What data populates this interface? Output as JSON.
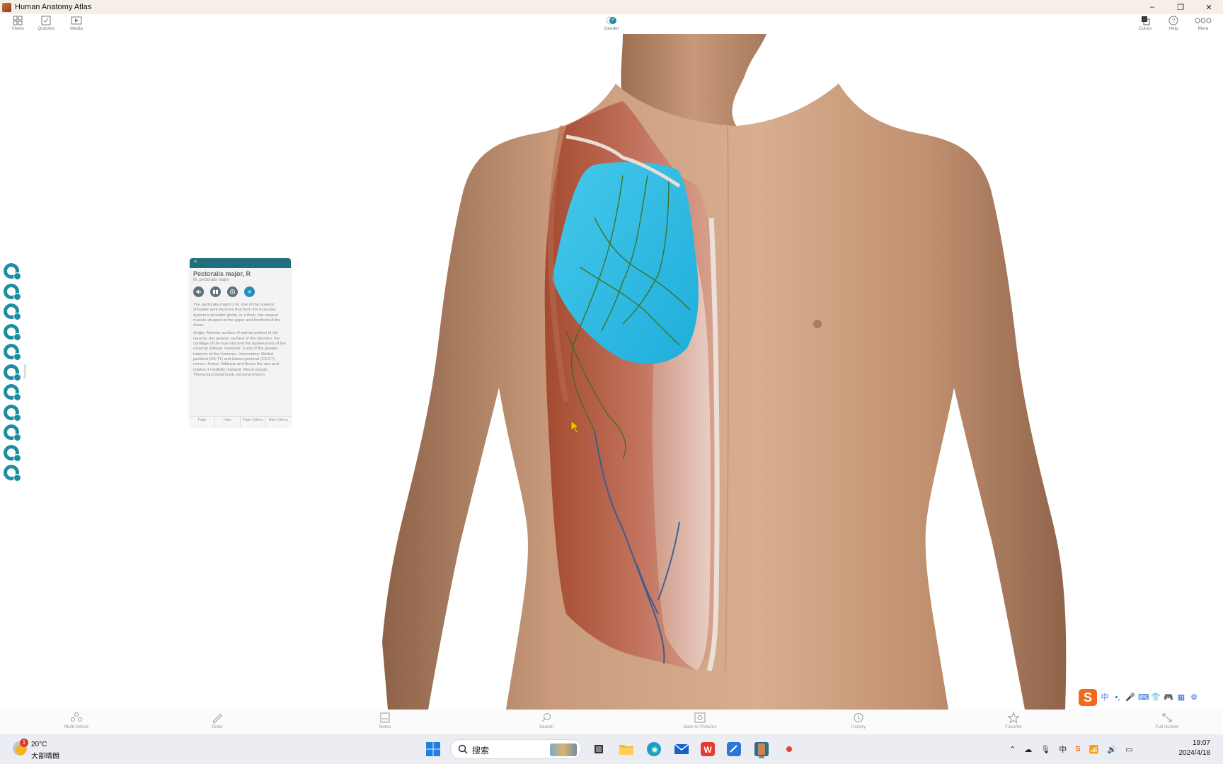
{
  "window": {
    "title": "Human Anatomy Atlas",
    "controls": [
      "–",
      "❐",
      "✕"
    ]
  },
  "top_toolbar": {
    "left": [
      {
        "label": "Views",
        "icon": "grid-icon"
      },
      {
        "label": "Quizzes",
        "icon": "quiz-icon"
      },
      {
        "label": "Media",
        "icon": "media-icon"
      }
    ],
    "center": {
      "label": "Gender",
      "icon": "gender-icon"
    },
    "right": [
      {
        "label": "Colors",
        "icon": "colors-icon"
      },
      {
        "label": "Help",
        "icon": "help-icon"
      },
      {
        "label": "More",
        "icon": "more-icon"
      }
    ]
  },
  "left_rail": {
    "label": "Anatomy",
    "items": [
      "skeletal-system",
      "ligaments",
      "muscular-system",
      "muscle-insertions",
      "nervous-system",
      "circulatory-system",
      "respiratory-system",
      "digestive-system",
      "lymphatic-system",
      "urinary-system",
      "reproductive-system"
    ]
  },
  "info_panel": {
    "collapse_glyph": "^",
    "name": "Pectoralis major, R",
    "latin": "M. pectoralis major",
    "description": "The pectoralis major is R, one of the anterior shoulder joint muscles that form the muscular system's shoulder girdle, is a thick, fan-shaped muscle situated at the upper and forefront of the chest.",
    "details": "Origin: Anterior surface of sternal portion of the clavicle, the anterior surface of the sternum, the cartilage of the true ribs and the aponeurosis of the external oblique. Insertion: Crest of the greater tubercle of the humerus. Innervation: Medial pectoral (C8-T1) and lateral pectoral (C5-C7) nerves. Action: Adducts and flexes the arm and rotates it medially (inward). Blood supply: Thoracoacromial trunk, pectoral branch",
    "buttons": [
      "Fade",
      "Hide",
      "Fade Others",
      "Hide Others"
    ]
  },
  "bottom_toolbar": [
    {
      "label": "Multi-Select",
      "icon": "multiselect-icon"
    },
    {
      "label": "Draw",
      "icon": "draw-icon"
    },
    {
      "label": "Notes",
      "icon": "notes-icon"
    },
    {
      "label": "Search",
      "icon": "search-icon"
    },
    {
      "label": "Save to Pictures",
      "icon": "save-pictures-icon"
    },
    {
      "label": "History",
      "icon": "history-icon"
    },
    {
      "label": "Favorite",
      "icon": "favorite-icon"
    },
    {
      "label": "Full Screen",
      "icon": "fullscreen-icon"
    }
  ],
  "ime": {
    "logo": "S",
    "mode": "中",
    "items": [
      "•,",
      "🎤",
      "⌨",
      "👕",
      "🎮",
      "▦",
      "⚙"
    ]
  },
  "taskbar": {
    "weather": {
      "temp": "20°C",
      "condition": "大部晴朗",
      "badge": "1"
    },
    "search_placeholder": "搜索",
    "tray": {
      "lang": "中",
      "input_method": "S"
    },
    "clock": {
      "time": "19:07",
      "date": "2024/4/18"
    }
  },
  "colors": {
    "accent": "#1d8ea2",
    "panel_header": "#1f6f7d",
    "highlight_muscle": "#2bbbe0",
    "skin": "#c79a7a"
  }
}
